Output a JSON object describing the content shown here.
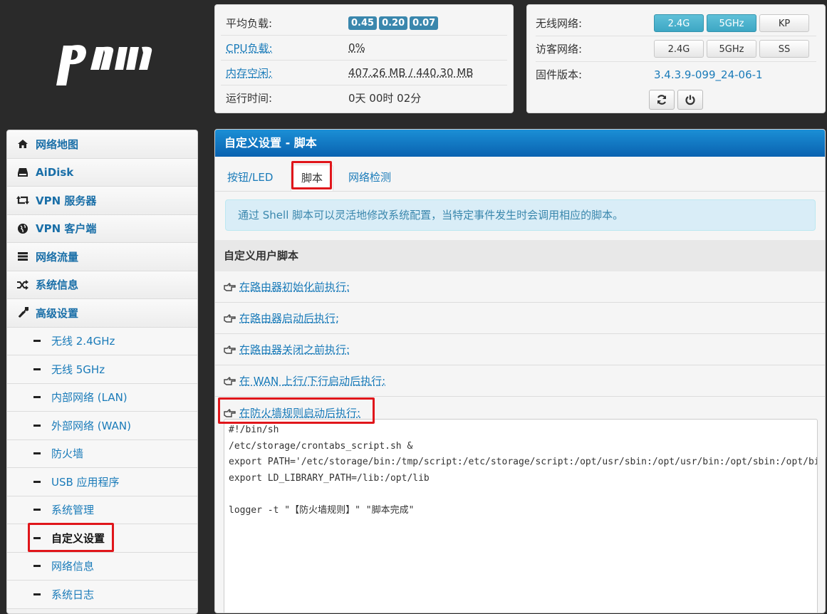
{
  "logo": {
    "text": "pdcn"
  },
  "status": {
    "load_label": "平均负载:",
    "load_values": [
      "0.45",
      "0.20",
      "0.07"
    ],
    "cpu_label": "CPU负载:",
    "cpu_value": "0%",
    "mem_label": "内存空闲:",
    "mem_value": "407.26 MB / 440.30 MB",
    "uptime_label": "运行时间:",
    "uptime_value": "0天 00时 02分"
  },
  "wireless": {
    "wifi_label": "无线网络:",
    "wifi_buttons": [
      "2.4G",
      "5GHz",
      "KP"
    ],
    "guest_label": "访客网络:",
    "guest_buttons": [
      "2.4G",
      "5GHz",
      "SS"
    ],
    "fw_label": "固件版本:",
    "fw_value": "3.4.3.9-099_24-06-1",
    "icons": [
      "refresh-icon",
      "power-icon"
    ]
  },
  "sidebar": {
    "items": [
      {
        "label": "网络地图",
        "icon": "home-icon"
      },
      {
        "label": "AiDisk",
        "icon": "hdd-icon"
      },
      {
        "label": "VPN 服务器",
        "icon": "retweet-icon"
      },
      {
        "label": "VPN 客户端",
        "icon": "globe-icon"
      },
      {
        "label": "网络流量",
        "icon": "tasks-icon"
      },
      {
        "label": "系统信息",
        "icon": "random-icon"
      },
      {
        "label": "高级设置",
        "icon": "wrench-icon"
      }
    ],
    "sub_items": [
      "无线 2.4GHz",
      "无线 5GHz",
      "内部网络 (LAN)",
      "外部网络 (WAN)",
      "防火墙",
      "USB 应用程序",
      "系统管理",
      "自定义设置",
      "网络信息",
      "系统日志"
    ],
    "active_sub": "自定义设置"
  },
  "main": {
    "title": "自定义设置 - 脚本",
    "tabs": [
      "按钮/LED",
      "脚本",
      "网络检测"
    ],
    "active_tab": "脚本",
    "info": "通过 Shell 脚本可以灵活地修改系统配置，当特定事件发生时会调用相应的脚本。",
    "section_title": "自定义用户脚本",
    "scripts": [
      "在路由器初始化前执行:",
      "在路由器启动后执行:",
      "在路由器关闭之前执行:",
      "在 WAN 上行/下行启动后执行:",
      "在防火墙规则启动后执行:"
    ],
    "code": [
      "#!/bin/sh",
      "/etc/storage/crontabs_script.sh &",
      "export PATH='/etc/storage/bin:/tmp/script:/etc/storage/script:/opt/usr/sbin:/opt/usr/bin:/opt/sbin:/opt/bin:/usr/local/sbin:/usr/sbin:/usr/bin:/sbin:/bin'",
      "export LD_LIBRARY_PATH=/lib:/opt/lib",
      "",
      "logger -t \"【防火墙规则】\" \"脚本完成\""
    ]
  },
  "colors": {
    "accent": "#1a7bb9",
    "header": "#0a62b0",
    "highlight": "#e0161b",
    "badge": "#3a87ad"
  }
}
